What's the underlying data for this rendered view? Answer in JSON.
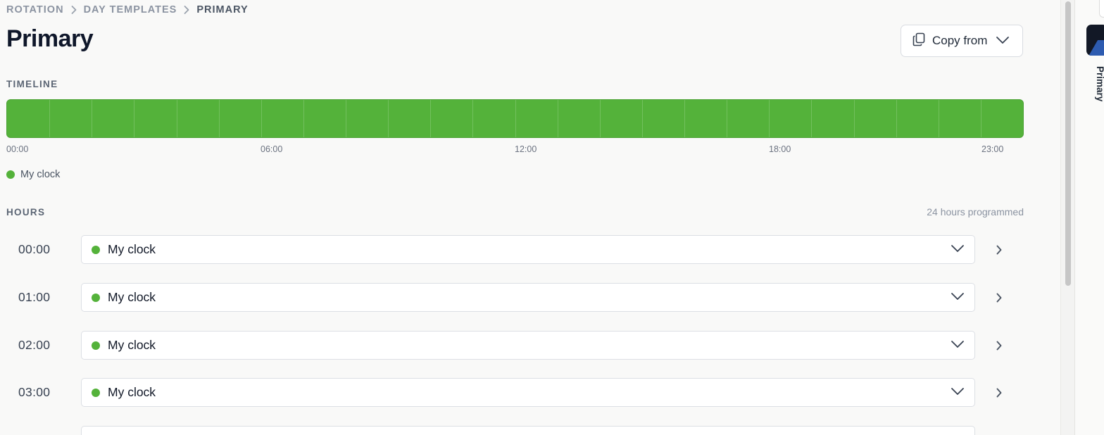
{
  "breadcrumb": {
    "items": [
      "ROTATION",
      "DAY TEMPLATES",
      "PRIMARY"
    ]
  },
  "header": {
    "title": "Primary",
    "copy_from_label": "Copy from"
  },
  "timeline": {
    "section_label": "TIMELINE",
    "segment_color": "#54b23a",
    "hour_count": 24,
    "tick_labels": [
      "00:00",
      "06:00",
      "12:00",
      "18:00",
      "23:00"
    ],
    "legend": {
      "label": "My clock",
      "color": "#54b23a"
    }
  },
  "hours": {
    "section_label": "HOURS",
    "summary": "24 hours programmed",
    "rows": [
      {
        "time": "00:00",
        "clock": "My clock"
      },
      {
        "time": "01:00",
        "clock": "My clock"
      },
      {
        "time": "02:00",
        "clock": "My clock"
      },
      {
        "time": "03:00",
        "clock": "My clock"
      }
    ]
  },
  "side_panel": {
    "label": "Primary"
  }
}
